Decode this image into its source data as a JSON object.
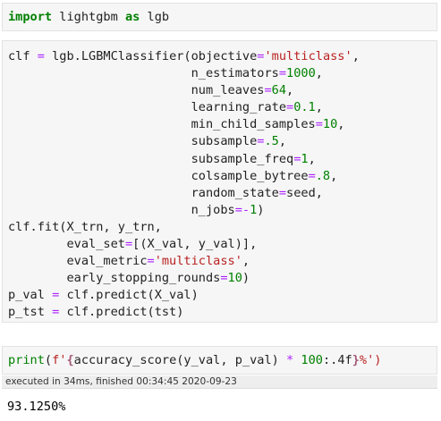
{
  "cells": [
    {
      "lines": [
        [
          [
            "kw",
            "import"
          ],
          [
            "t",
            " lightgbm "
          ],
          [
            "kw",
            "as"
          ],
          [
            "t",
            " lgb"
          ]
        ]
      ]
    },
    {
      "lines": [
        [
          [
            "t",
            "clf "
          ],
          [
            "op",
            "="
          ],
          [
            "t",
            " lgb.LGBMClassifier(objective"
          ],
          [
            "op",
            "="
          ],
          [
            "str",
            "'multiclass'"
          ],
          [
            "t",
            ","
          ]
        ],
        [
          [
            "t",
            "                         n_estimators"
          ],
          [
            "op",
            "="
          ],
          [
            "num",
            "1000"
          ],
          [
            "t",
            ","
          ]
        ],
        [
          [
            "t",
            "                         num_leaves"
          ],
          [
            "op",
            "="
          ],
          [
            "num",
            "64"
          ],
          [
            "t",
            ","
          ]
        ],
        [
          [
            "t",
            "                         learning_rate"
          ],
          [
            "op",
            "="
          ],
          [
            "num",
            "0.1"
          ],
          [
            "t",
            ","
          ]
        ],
        [
          [
            "t",
            "                         min_child_samples"
          ],
          [
            "op",
            "="
          ],
          [
            "num",
            "10"
          ],
          [
            "t",
            ","
          ]
        ],
        [
          [
            "t",
            "                         subsample"
          ],
          [
            "op",
            "="
          ],
          [
            "num",
            ".5"
          ],
          [
            "t",
            ","
          ]
        ],
        [
          [
            "t",
            "                         subsample_freq"
          ],
          [
            "op",
            "="
          ],
          [
            "num",
            "1"
          ],
          [
            "t",
            ","
          ]
        ],
        [
          [
            "t",
            "                         colsample_bytree"
          ],
          [
            "op",
            "="
          ],
          [
            "num",
            ".8"
          ],
          [
            "t",
            ","
          ]
        ],
        [
          [
            "t",
            "                         random_state"
          ],
          [
            "op",
            "="
          ],
          [
            "t",
            "seed,"
          ]
        ],
        [
          [
            "t",
            "                         n_jobs"
          ],
          [
            "op",
            "=-"
          ],
          [
            "num",
            "1"
          ],
          [
            "t",
            ")"
          ]
        ],
        [
          [
            "t",
            "clf.fit(X_trn, y_trn,"
          ]
        ],
        [
          [
            "t",
            "        eval_set"
          ],
          [
            "op",
            "="
          ],
          [
            "t",
            "[(X_val, y_val)],"
          ]
        ],
        [
          [
            "t",
            "        eval_metric"
          ],
          [
            "op",
            "="
          ],
          [
            "str",
            "'multiclass'"
          ],
          [
            "t",
            ","
          ]
        ],
        [
          [
            "t",
            "        early_stopping_rounds"
          ],
          [
            "op",
            "="
          ],
          [
            "num",
            "10"
          ],
          [
            "t",
            ")"
          ]
        ],
        [
          [
            "t",
            "p_val "
          ],
          [
            "op",
            "="
          ],
          [
            "t",
            " clf.predict(X_val)"
          ]
        ],
        [
          [
            "t",
            "p_tst "
          ],
          [
            "op",
            "="
          ],
          [
            "t",
            " clf.predict(tst)"
          ]
        ]
      ]
    },
    {
      "lines": [
        [
          [
            "bi",
            "print"
          ],
          [
            "t",
            "("
          ],
          [
            "fs",
            "f'"
          ],
          [
            "fsi",
            "{"
          ],
          [
            "t",
            "accuracy_score(y_val, p_val) "
          ],
          [
            "op",
            "*"
          ],
          [
            "t",
            " "
          ],
          [
            "num",
            "100"
          ],
          [
            "t",
            ":.4f"
          ],
          [
            "fsi",
            "}"
          ],
          [
            "fs",
            "%')"
          ]
        ]
      ]
    }
  ],
  "status": "executed in 34ms, finished 00:34:45 2020-09-23",
  "output": "93.1250%"
}
